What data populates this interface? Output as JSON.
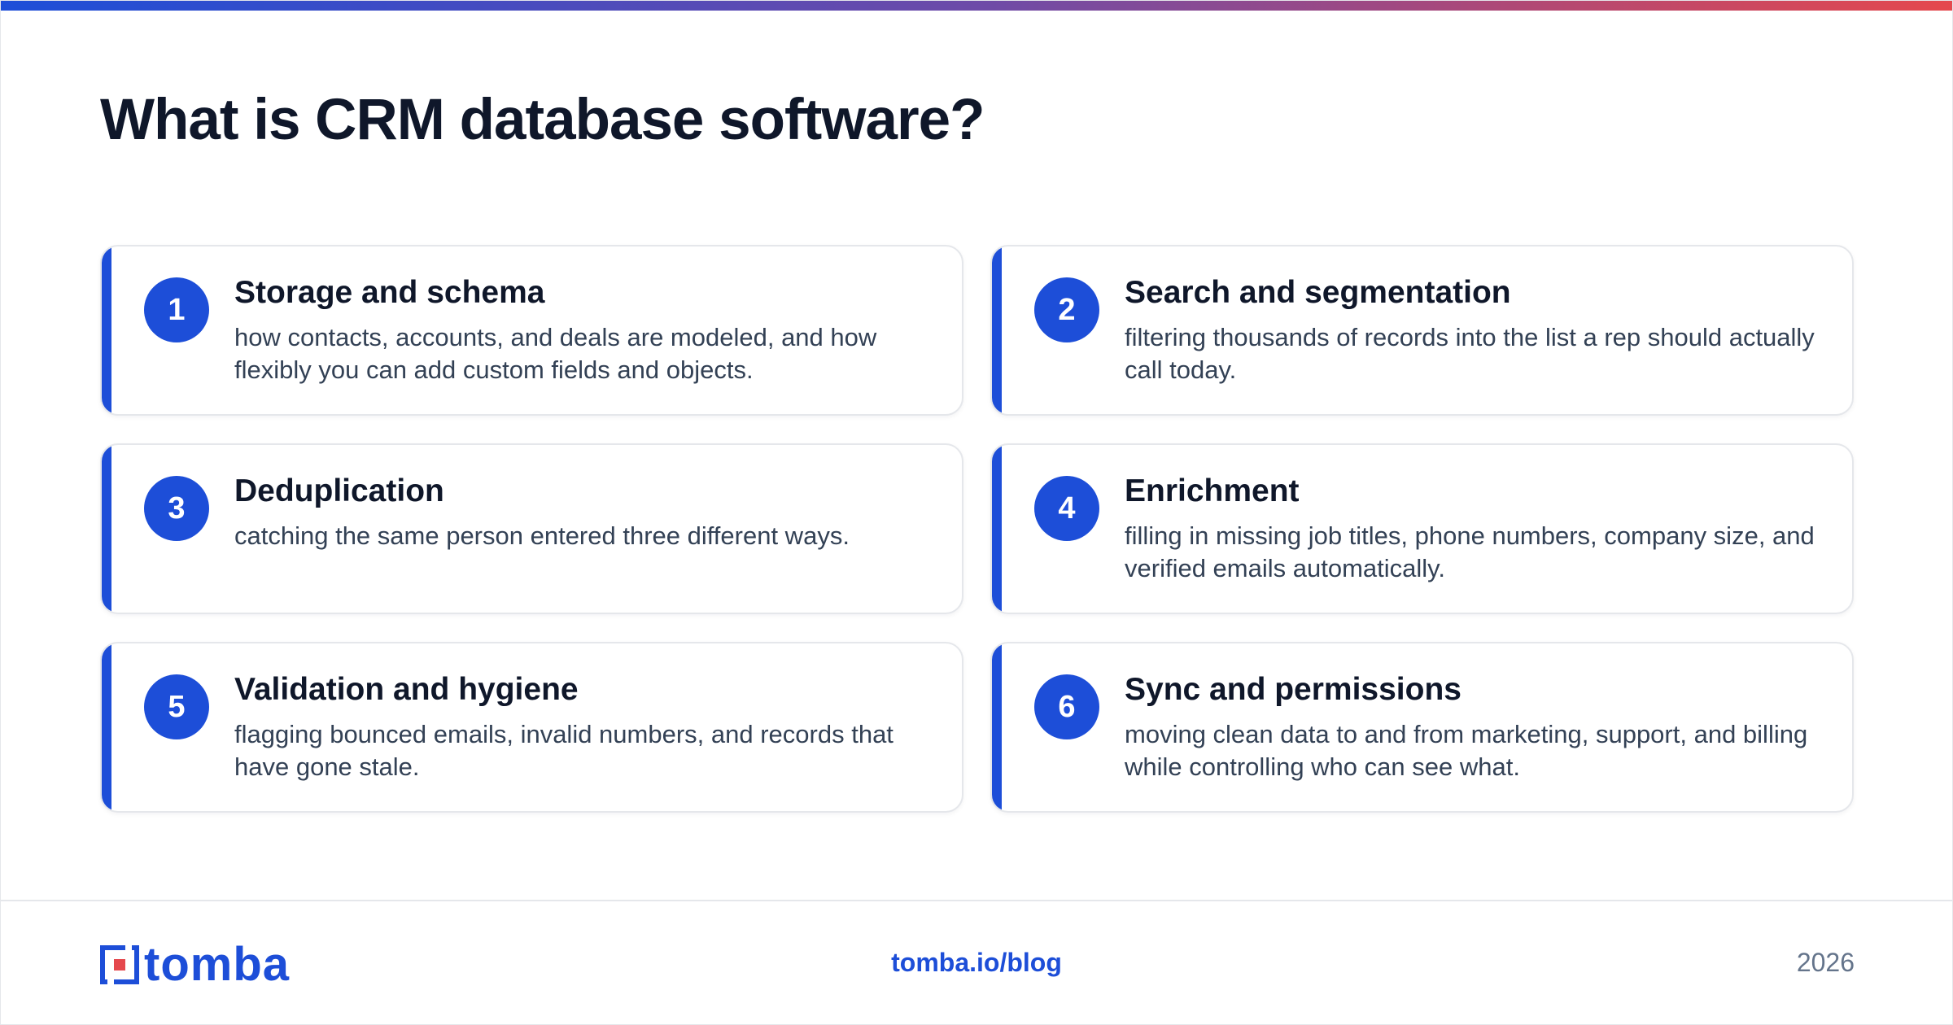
{
  "title": "What is CRM database software?",
  "cards": [
    {
      "number": "1",
      "title": "Storage and schema",
      "description": "how contacts, accounts, and deals are modeled, and how flexibly you can add custom fields and objects."
    },
    {
      "number": "2",
      "title": "Search and segmentation",
      "description": "filtering thousands of records into the list a rep should actually call today."
    },
    {
      "number": "3",
      "title": "Deduplication",
      "description": "catching the same person entered three different ways."
    },
    {
      "number": "4",
      "title": "Enrichment",
      "description": "filling in missing job titles, phone numbers, company size, and verified emails automatically."
    },
    {
      "number": "5",
      "title": "Validation and hygiene",
      "description": "flagging bounced emails, invalid numbers, and records that have gone stale."
    },
    {
      "number": "6",
      "title": "Sync and permissions",
      "description": "moving clean data to and from marketing, support, and billing while controlling who can see what."
    }
  ],
  "footer": {
    "logo_text": "tomba",
    "logo_icon": "tomba-logo-mark-icon",
    "link": "tomba.io/blog",
    "year": "2026"
  },
  "colors": {
    "accent": "#1d4ed8",
    "heading": "#0f172a",
    "body_text": "#334155",
    "muted": "#64748b",
    "logo_red": "#e5484d",
    "gradient_start": "#1d4ed8",
    "gradient_end": "#e5484d"
  }
}
